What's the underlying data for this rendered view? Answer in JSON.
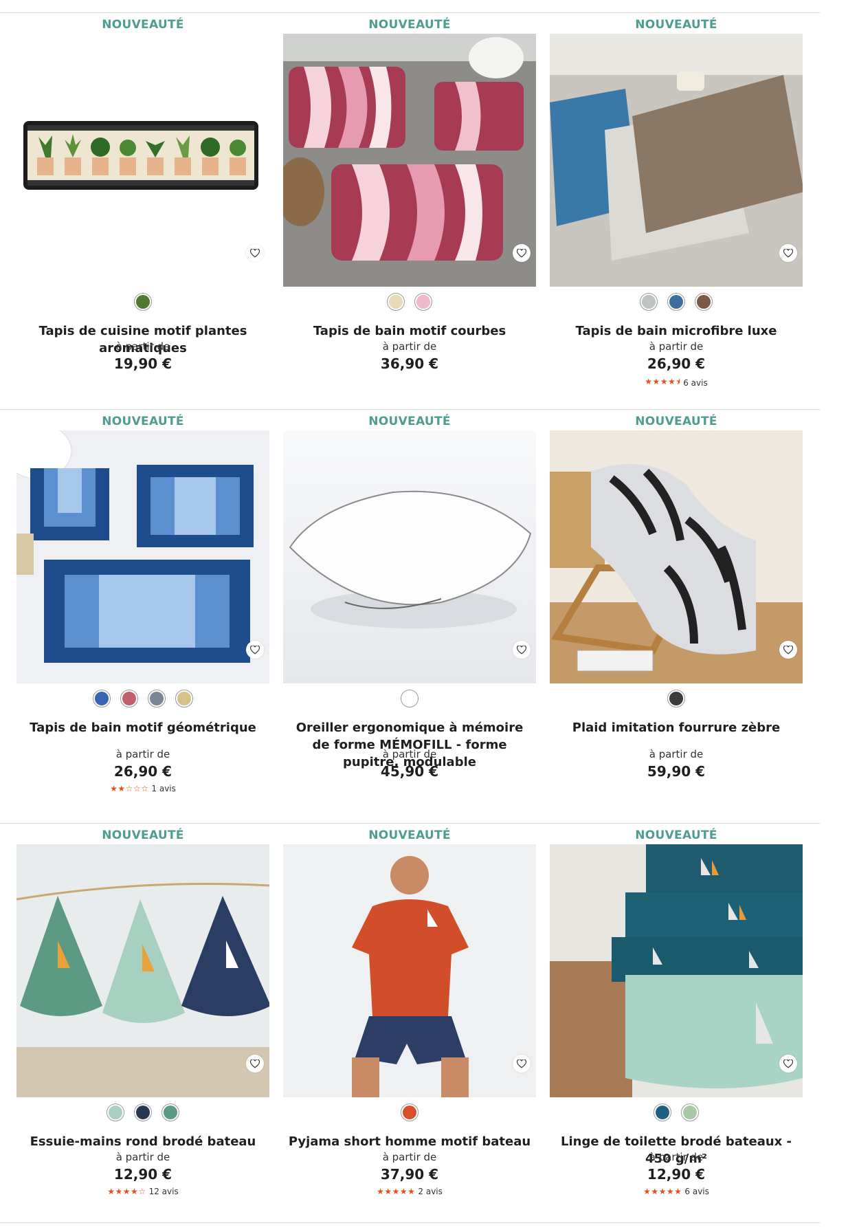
{
  "badge": "NOUVEAUTÉ",
  "from_label": "à partir de",
  "products": [
    {
      "title": "Tapis de cuisine motif plantes aromatiques",
      "price": "19,90 €",
      "swatches": [
        "#4f7a33"
      ],
      "rating": null,
      "reviews": ""
    },
    {
      "title": "Tapis de bain motif courbes",
      "price": "36,90 €",
      "swatches": [
        "#e8d8b8",
        "#f0b8c8"
      ],
      "rating": null,
      "reviews": ""
    },
    {
      "title": "Tapis de bain microfibre luxe",
      "price": "26,90 €",
      "swatches": [
        "#bfc3c4",
        "#3d6f9c",
        "#7a5a45"
      ],
      "rating": 4.5,
      "reviews": "6 avis"
    },
    {
      "title": "Tapis de bain motif géométrique",
      "price": "26,90 €",
      "swatches": [
        "#3a63b4",
        "#c0606e",
        "#7a8596",
        "#d8c08a"
      ],
      "rating": 2,
      "reviews": "1 avis"
    },
    {
      "title": "Oreiller ergonomique à mémoire de forme MÉMOFILL - forme pupitre, modulable",
      "price": "45,90 €",
      "swatches": [
        "#ffffff"
      ],
      "rating": null,
      "reviews": ""
    },
    {
      "title": "Plaid imitation fourrure zèbre",
      "price": "59,90 €",
      "swatches": [
        "#3a3a3a"
      ],
      "rating": null,
      "reviews": ""
    },
    {
      "title": "Essuie-mains rond brodé bateau",
      "price": "12,90 €",
      "swatches": [
        "#a8cfc4",
        "#26374f",
        "#5a9a82"
      ],
      "rating": 4,
      "reviews": "12 avis"
    },
    {
      "title": "Pyjama short homme motif bateau",
      "price": "37,90 €",
      "swatches": [
        "#d94f28"
      ],
      "rating": 5,
      "reviews": "2 avis"
    },
    {
      "title": "Linge de toilette brodé bateaux - 450 g/m²",
      "price": "12,90 €",
      "swatches": [
        "#1f5f7f",
        "#a8c8a8"
      ],
      "rating": 5,
      "reviews": "6 avis"
    }
  ]
}
